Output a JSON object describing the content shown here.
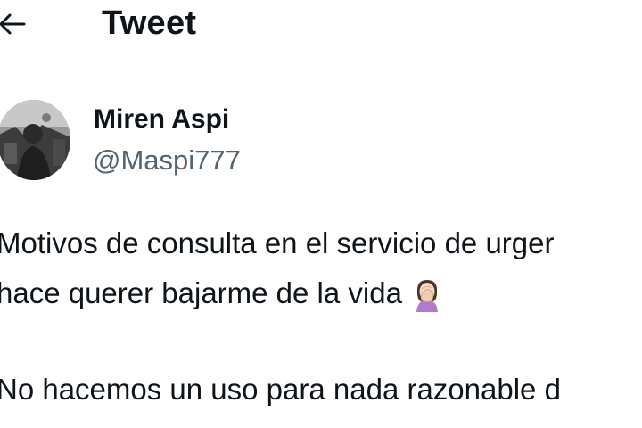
{
  "header": {
    "back_icon": "arrow-left-icon",
    "title": "Tweet"
  },
  "author": {
    "avatar_icon": "avatar-photo",
    "name": "Miren Aspi",
    "handle": "@Maspi777"
  },
  "tweet": {
    "line1": "Motivos de consulta en el servicio de urger",
    "line2": "hace querer bajarme de la vida",
    "emoji_icon": "woman-facepalming-icon",
    "line3": "No hacemos un uso para nada razonable d"
  },
  "colors": {
    "text": "#0f1419",
    "secondary": "#536471",
    "background": "#ffffff"
  }
}
